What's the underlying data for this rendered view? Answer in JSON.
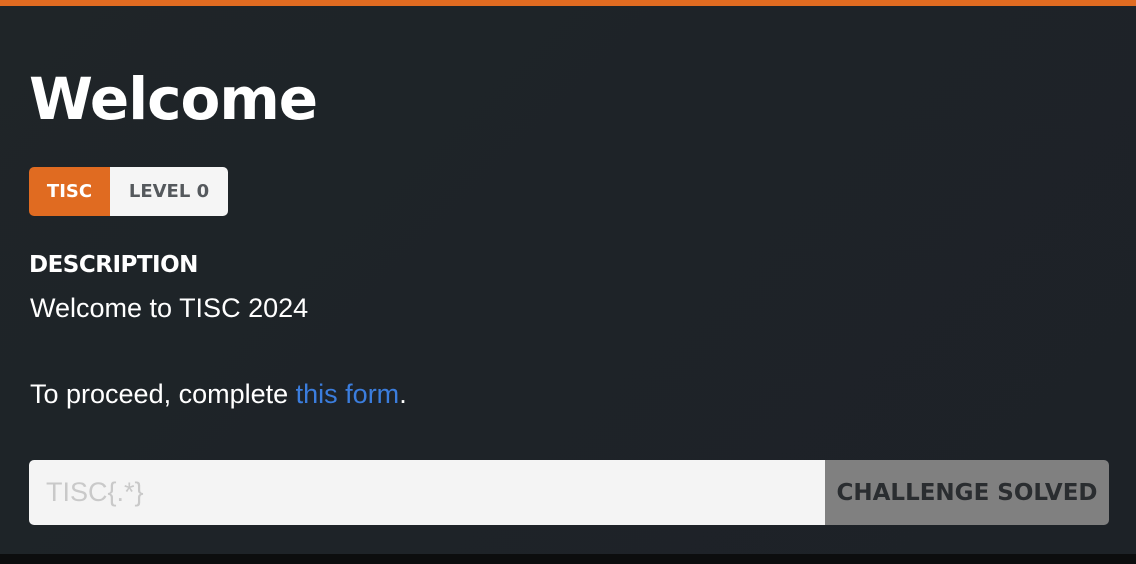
{
  "challenge": {
    "title": "Welcome",
    "category_tag": "TISC",
    "level_tag": "LEVEL 0",
    "description_label": "DESCRIPTION",
    "description_line_1": "Welcome to TISC 2024",
    "description_line_2_prefix": "To proceed, complete ",
    "description_link_text": "this form",
    "description_line_2_suffix": "."
  },
  "flag_form": {
    "input_placeholder": "TISC{.*}",
    "input_value": "",
    "submit_label": "CHALLENGE SOLVED"
  },
  "colors": {
    "accent": "#e06b21",
    "panel_background": "#1f2428",
    "link": "#3b7ddd",
    "submit_disabled": "#808080"
  }
}
